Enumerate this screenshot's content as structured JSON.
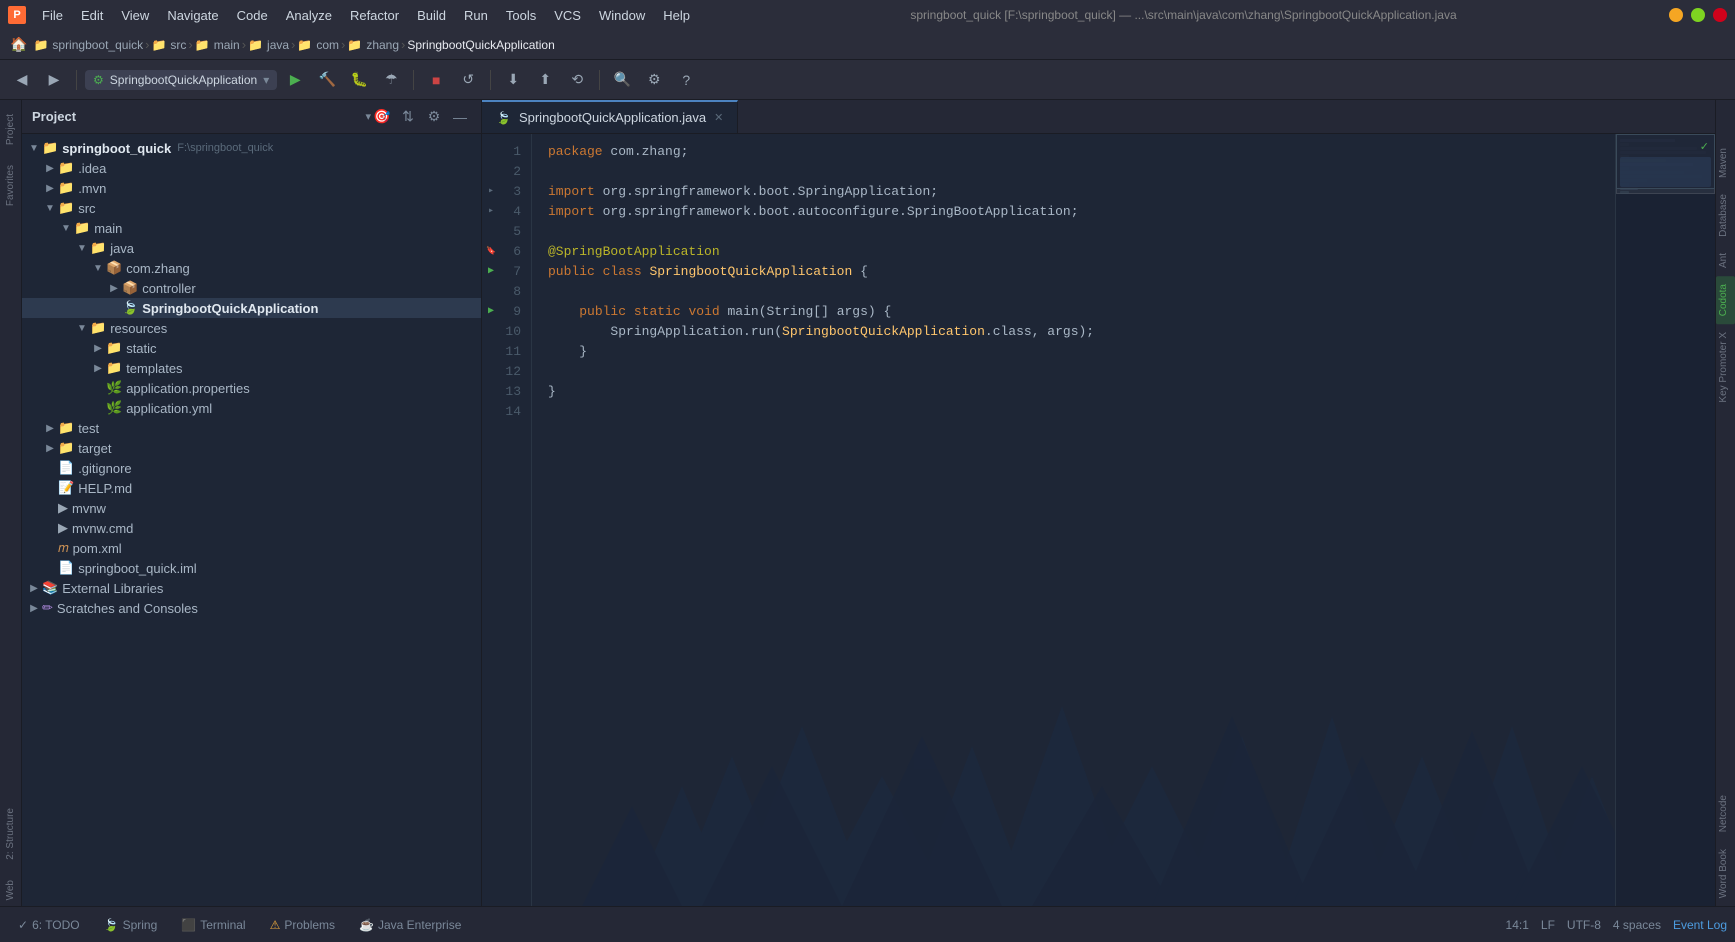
{
  "titleBar": {
    "logo": "P",
    "menus": [
      "File",
      "Edit",
      "View",
      "Navigate",
      "Code",
      "Analyze",
      "Refactor",
      "Build",
      "Run",
      "Tools",
      "VCS",
      "Window",
      "Help"
    ],
    "path": "springboot_quick [F:\\springboot_quick] — ...\\src\\main\\java\\com\\zhang\\SpringbootQuickApplication.java",
    "windowControls": [
      "minimize",
      "maximize",
      "close"
    ]
  },
  "breadcrumb": {
    "items": [
      "springboot_quick",
      "src",
      "main",
      "java",
      "com",
      "zhang",
      "SpringbootQuickApplication"
    ]
  },
  "runConfig": {
    "name": "SpringbootQuickApplication",
    "label": "SpringbootQuickApplication"
  },
  "projectPanel": {
    "title": "Project",
    "tree": [
      {
        "id": "springboot_quick",
        "label": "springboot_quick",
        "extra": "F:\\springboot_quick",
        "type": "root",
        "level": 0,
        "expanded": true,
        "icon": "folder"
      },
      {
        "id": "idea",
        "label": ".idea",
        "type": "folder",
        "level": 1,
        "expanded": false,
        "icon": "folder"
      },
      {
        "id": "mvn",
        "label": ".mvn",
        "type": "folder",
        "level": 1,
        "expanded": false,
        "icon": "folder"
      },
      {
        "id": "src",
        "label": "src",
        "type": "folder",
        "level": 1,
        "expanded": true,
        "icon": "folder"
      },
      {
        "id": "main",
        "label": "main",
        "type": "folder",
        "level": 2,
        "expanded": true,
        "icon": "folder"
      },
      {
        "id": "java",
        "label": "java",
        "type": "folder",
        "level": 3,
        "expanded": true,
        "icon": "folder"
      },
      {
        "id": "comzhang",
        "label": "com.zhang",
        "type": "package",
        "level": 4,
        "expanded": true,
        "icon": "folder-yellow"
      },
      {
        "id": "controller",
        "label": "controller",
        "type": "package",
        "level": 5,
        "expanded": false,
        "icon": "folder-yellow"
      },
      {
        "id": "SpringbootQuickApplication",
        "label": "SpringbootQuickApplication",
        "type": "java",
        "level": 5,
        "expanded": false,
        "icon": "spring"
      },
      {
        "id": "resources",
        "label": "resources",
        "type": "folder",
        "level": 3,
        "expanded": true,
        "icon": "folder"
      },
      {
        "id": "static",
        "label": "static",
        "type": "folder",
        "level": 4,
        "expanded": false,
        "icon": "folder"
      },
      {
        "id": "templates",
        "label": "templates",
        "type": "folder",
        "level": 4,
        "expanded": false,
        "icon": "folder"
      },
      {
        "id": "application_properties",
        "label": "application.properties",
        "type": "properties",
        "level": 4,
        "icon": "properties"
      },
      {
        "id": "application_yml",
        "label": "application.yml",
        "type": "yaml",
        "level": 4,
        "icon": "yaml"
      },
      {
        "id": "test",
        "label": "test",
        "type": "folder",
        "level": 1,
        "expanded": false,
        "icon": "folder"
      },
      {
        "id": "target",
        "label": "target",
        "type": "folder",
        "level": 1,
        "expanded": false,
        "icon": "folder-yellow"
      },
      {
        "id": "gitignore",
        "label": ".gitignore",
        "type": "file",
        "level": 1,
        "icon": "gitignore"
      },
      {
        "id": "HELP",
        "label": "HELP.md",
        "type": "md",
        "level": 1,
        "icon": "md"
      },
      {
        "id": "mvnw",
        "label": "mvnw",
        "type": "file",
        "level": 1,
        "icon": "file"
      },
      {
        "id": "mvnw_cmd",
        "label": "mvnw.cmd",
        "type": "file",
        "level": 1,
        "icon": "file"
      },
      {
        "id": "pom",
        "label": "pom.xml",
        "type": "xml",
        "level": 1,
        "icon": "xml"
      },
      {
        "id": "springboot_quick_iml",
        "label": "springboot_quick.iml",
        "type": "iml",
        "level": 1,
        "icon": "iml"
      },
      {
        "id": "external_libraries",
        "label": "External Libraries",
        "type": "external",
        "level": 0,
        "expanded": false,
        "icon": "lib"
      },
      {
        "id": "scratches",
        "label": "Scratches and Consoles",
        "type": "scratch",
        "level": 0,
        "expanded": false,
        "icon": "scratch"
      }
    ]
  },
  "editor": {
    "tabs": [
      {
        "id": "SpringbootQuickApplication",
        "label": "SpringbootQuickApplication.java",
        "active": true,
        "icon": "spring"
      }
    ],
    "lines": [
      {
        "num": 1,
        "code": "package com.zhang;",
        "gutters": []
      },
      {
        "num": 2,
        "code": "",
        "gutters": []
      },
      {
        "num": 3,
        "code": "import org.springframework.boot.SpringApplication;",
        "gutters": [
          "fold"
        ]
      },
      {
        "num": 4,
        "code": "import org.springframework.boot.autoconfigure.SpringBootApplication;",
        "gutters": [
          "fold"
        ]
      },
      {
        "num": 5,
        "code": "",
        "gutters": []
      },
      {
        "num": 6,
        "code": "@SpringBootApplication",
        "gutters": [
          "bookmark"
        ]
      },
      {
        "num": 7,
        "code": "public class SpringbootQuickApplication {",
        "gutters": [
          "bookmark",
          "run"
        ]
      },
      {
        "num": 8,
        "code": "",
        "gutters": []
      },
      {
        "num": 9,
        "code": "    public static void main(String[] args) {",
        "gutters": [
          "run"
        ]
      },
      {
        "num": 10,
        "code": "        SpringApplication.run(SpringbootQuickApplication.class, args);",
        "gutters": []
      },
      {
        "num": 11,
        "code": "    }",
        "gutters": []
      },
      {
        "num": 12,
        "code": "",
        "gutters": []
      },
      {
        "num": 13,
        "code": "}",
        "gutters": []
      },
      {
        "num": 14,
        "code": "",
        "gutters": []
      }
    ]
  },
  "rightSidebar": {
    "tabs": [
      "Maven",
      "Database",
      "Ant",
      "Codota",
      "Key Promoter X",
      "Netcode",
      "Word Book"
    ]
  },
  "bottomBar": {
    "tabs": [
      {
        "id": "todo",
        "label": "6: TODO",
        "icon": "check"
      },
      {
        "id": "spring",
        "label": "Spring",
        "icon": "leaf"
      },
      {
        "id": "terminal",
        "label": "Terminal",
        "icon": "terminal"
      },
      {
        "id": "problems",
        "label": "Problems",
        "icon": "warning"
      },
      {
        "id": "java_enterprise",
        "label": "Java Enterprise",
        "icon": "java"
      }
    ],
    "statusRight": {
      "position": "14:1",
      "encoding": "UTF-8",
      "lineEnding": "LF",
      "indentation": "4 spaces",
      "eventLog": "Event Log"
    }
  },
  "leftStrip": {
    "items": [
      "Project",
      "Favorites",
      "Structure",
      "Web"
    ]
  }
}
